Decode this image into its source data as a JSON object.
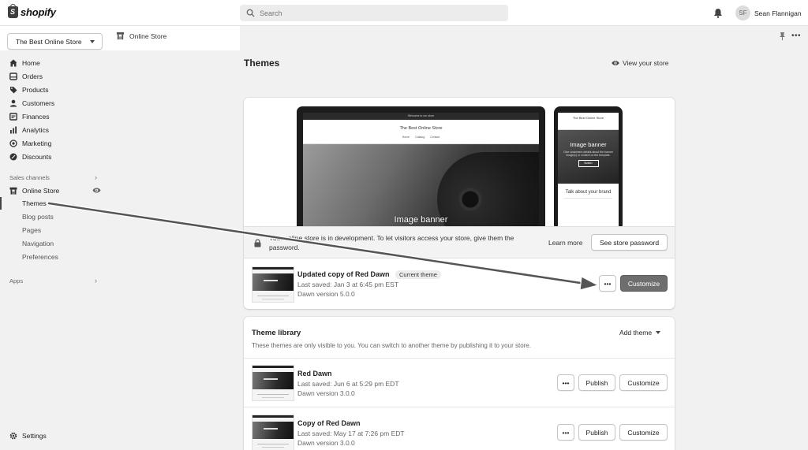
{
  "topbar": {
    "brand": "shopify",
    "search_placeholder": "Search",
    "user_initials": "SF",
    "user_name": "Sean Flannigan"
  },
  "store_selector": {
    "label": "The Best Online Store"
  },
  "breadcrumb": {
    "label": "Online Store"
  },
  "sidebar": {
    "items": [
      {
        "label": "Home",
        "icon": "home-icon"
      },
      {
        "label": "Orders",
        "icon": "orders-icon"
      },
      {
        "label": "Products",
        "icon": "tag-icon"
      },
      {
        "label": "Customers",
        "icon": "person-icon"
      },
      {
        "label": "Finances",
        "icon": "finances-icon"
      },
      {
        "label": "Analytics",
        "icon": "bar-chart-icon"
      },
      {
        "label": "Marketing",
        "icon": "target-icon"
      },
      {
        "label": "Discounts",
        "icon": "discount-icon"
      }
    ],
    "sales_channels_label": "Sales channels",
    "online_store_label": "Online Store",
    "sub_items": [
      "Themes",
      "Blog posts",
      "Pages",
      "Navigation",
      "Preferences"
    ],
    "apps_label": "Apps",
    "settings_label": "Settings"
  },
  "main": {
    "title": "Themes",
    "view_store": "View your store",
    "preview": {
      "laptop_announcement": "Welcome to our store",
      "laptop_store_title": "The Best Online Store",
      "laptop_nav": "Home  Catalog  Contact",
      "banner_label": "Image banner",
      "phone_store_title": "The Best Online Store",
      "phone_banner_title": "Image banner",
      "phone_banner_sub": "Give customers details about the banner image(s) or content on the template.",
      "phone_banner_button": "Button",
      "phone_text": "Talk about your brand"
    },
    "dev_notice": {
      "text": "Your online store is in development. To let visitors access your store, give them the password.",
      "learn_more": "Learn more",
      "password_button": "See store password"
    },
    "current_theme": {
      "name": "Updated copy of Red Dawn",
      "badge": "Current theme",
      "saved": "Last saved: Jan 3 at 6:45 pm EST",
      "version": "Dawn version 5.0.0",
      "more_label": "•••",
      "customize_label": "Customize"
    },
    "library": {
      "title": "Theme library",
      "description": "These themes are only visible to you. You can switch to another theme by publishing it to your store.",
      "add_theme": "Add theme",
      "themes": [
        {
          "name": "Red Dawn",
          "saved": "Last saved: Jun 6 at 5:29 pm EDT",
          "version": "Dawn version 3.0.0",
          "more": "•••",
          "publish": "Publish",
          "customize": "Customize"
        },
        {
          "name": "Copy of Red Dawn",
          "saved": "Last saved: May 17 at 7:26 pm EDT",
          "version": "Dawn version 3.0.0",
          "more": "•••",
          "publish": "Publish",
          "customize": "Customize"
        }
      ]
    }
  }
}
